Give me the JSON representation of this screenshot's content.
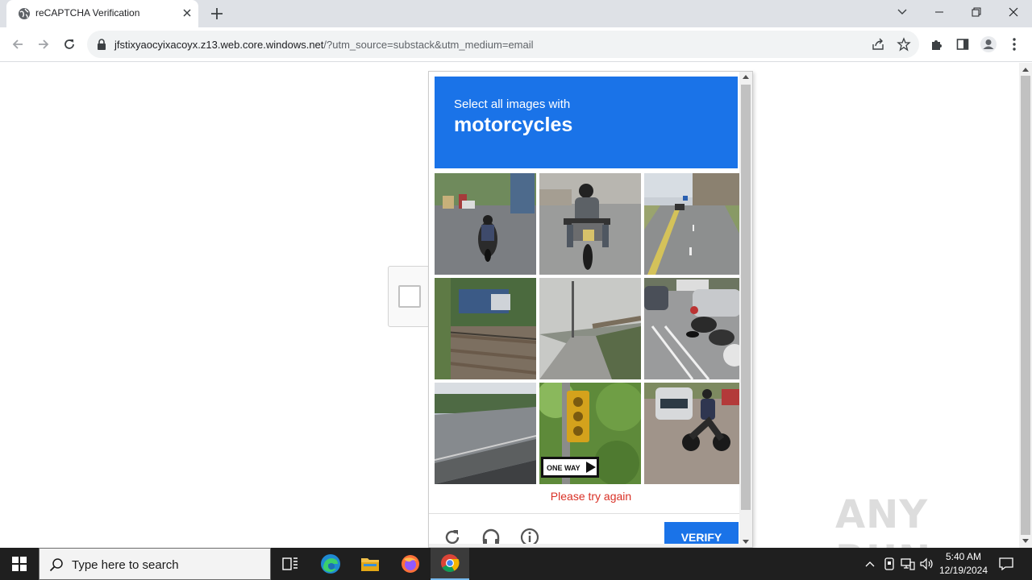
{
  "browser": {
    "tab": {
      "title": "reCAPTCHA Verification"
    },
    "address": {
      "host": "jfstixyaocyixacoyx.z13.web.core.windows.net",
      "path": "/?utm_source=substack&utm_medium=email"
    }
  },
  "captcha": {
    "instruction": "Select all images with",
    "target": "motorcycles",
    "error": "Please try again",
    "verify_label": "VERIFY",
    "tiles": [
      {
        "label": "Street with motorcyclists"
      },
      {
        "label": "Rider on motorcycle"
      },
      {
        "label": "Highway road"
      },
      {
        "label": "Railway tracks and fence"
      },
      {
        "label": "Bridge walkway"
      },
      {
        "label": "Parked motorcycles and cars"
      },
      {
        "label": "Road with barrier"
      },
      {
        "label": "Traffic light with one way sign",
        "sign_text": "ONE WAY"
      },
      {
        "label": "Motorcycle on street"
      }
    ]
  },
  "watermark": "ANY RUN",
  "taskbar": {
    "search_placeholder": "Type here to search",
    "time": "5:40 AM",
    "date": "12/19/2024"
  },
  "colors": {
    "accent": "#1a73e8",
    "error": "#d93025",
    "taskbar": "#1f1f1f"
  }
}
